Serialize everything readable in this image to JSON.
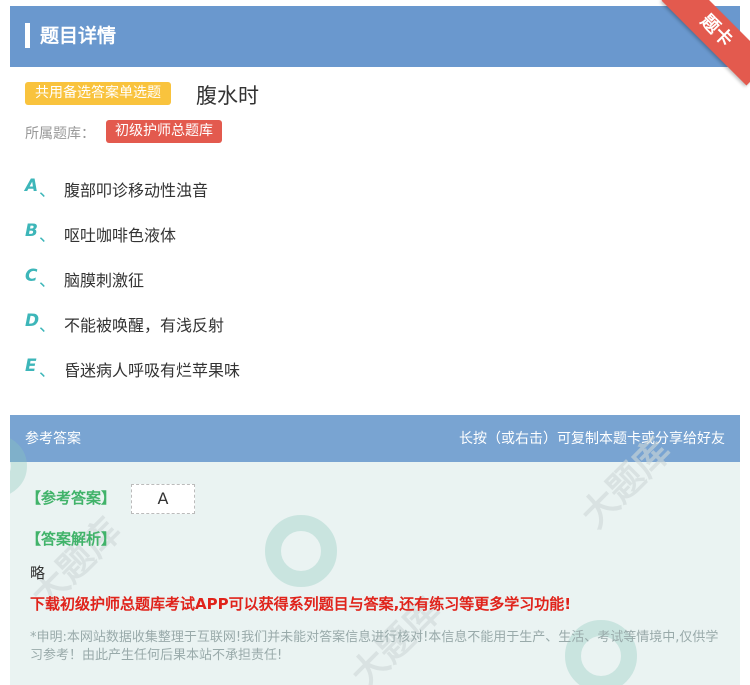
{
  "header": {
    "title": "题目详情"
  },
  "ribbon": {
    "label": "题卡"
  },
  "question": {
    "type_tag": "共用备选答案单选题",
    "text": "腹水时",
    "bank_label": "所属题库：",
    "bank_name": "初级护师总题库"
  },
  "options": [
    {
      "letter": "A",
      "sep": "、",
      "text": "腹部叩诊移动性浊音"
    },
    {
      "letter": "B",
      "sep": "、",
      "text": "呕吐咖啡色液体"
    },
    {
      "letter": "C",
      "sep": "、",
      "text": "脑膜刺激征"
    },
    {
      "letter": "D",
      "sep": "、",
      "text": "不能被唤醒，有浅反射"
    },
    {
      "letter": "E",
      "sep": "、",
      "text": "昏迷病人呼吸有烂苹果味"
    }
  ],
  "answer_panel": {
    "title": "参考答案",
    "hint": "长按（或右击）可复制本题卡或分享给好友",
    "answer_label": "【参考答案】",
    "answer_value": "A",
    "explain_label": "【答案解析】",
    "explain_text": "略",
    "promo": "下载初级护师总题库考试APP可以获得系列题目与答案,还有练习等更多学习功能!",
    "disclaimer": "*申明:本网站数据收集整理于互联网!我们并未能对答案信息进行核对!本信息不能用于生产、生活、考试等情境中,仅供学习参考！由此产生任何后果本站不承担责任!"
  },
  "colors": {
    "header": "#6a98ce",
    "ribbon": "#e35a4e",
    "type_tag": "#f9c33d",
    "option_letter": "#3db6b9",
    "answer_label": "#41b36a",
    "promo": "#e0231b"
  }
}
